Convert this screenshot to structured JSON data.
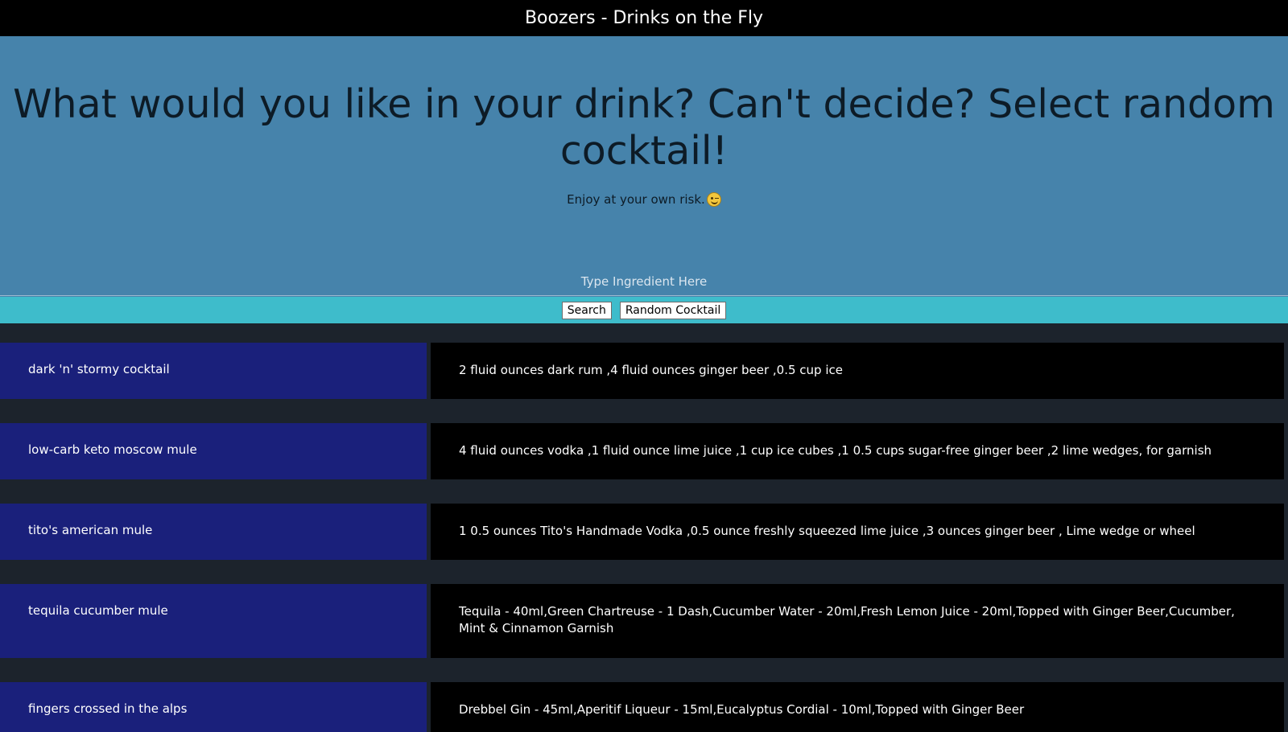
{
  "header": {
    "title": "Boozers - Drinks on the Fly"
  },
  "hero": {
    "headline": "What would you like in your drink? Can't decide? Select random cocktail!",
    "tagline": "Enjoy at your own risk.",
    "tagline_icon": "wink-emoji-icon"
  },
  "search": {
    "placeholder": "Type Ingredient Here",
    "search_label": "Search",
    "random_label": "Random Cocktail"
  },
  "colors": {
    "topbar": "#000000",
    "hero": "#4683ab",
    "button_bar": "#3ebccb",
    "page_bg": "#1c232c",
    "name_cell": "#1a207b",
    "recipe_cell": "#000000"
  },
  "results": [
    {
      "name": "dark 'n' stormy cocktail",
      "ingredients": "2 fluid ounces dark rum ,4 fluid ounces ginger beer ,0.5 cup ice"
    },
    {
      "name": "low-carb keto moscow mule",
      "ingredients": "4 fluid ounces vodka ,1 fluid ounce lime juice ,1 cup ice cubes ,1 0.5 cups sugar-free ginger beer ,2 lime wedges, for garnish"
    },
    {
      "name": "tito's american mule",
      "ingredients": "1 0.5 ounces Tito's Handmade Vodka ,0.5 ounce freshly squeezed lime juice ,3 ounces ginger beer , Lime wedge or wheel"
    },
    {
      "name": "tequila cucumber mule",
      "ingredients": "Tequila - 40ml,Green Chartreuse - 1 Dash,Cucumber Water - 20ml,Fresh Lemon Juice - 20ml,Topped with Ginger Beer,Cucumber, Mint & Cinnamon Garnish"
    },
    {
      "name": "fingers crossed in the alps",
      "ingredients": "Drebbel Gin - 45ml,Aperitif Liqueur - 15ml,Eucalyptus Cordial - 10ml,Topped with Ginger Beer"
    }
  ]
}
